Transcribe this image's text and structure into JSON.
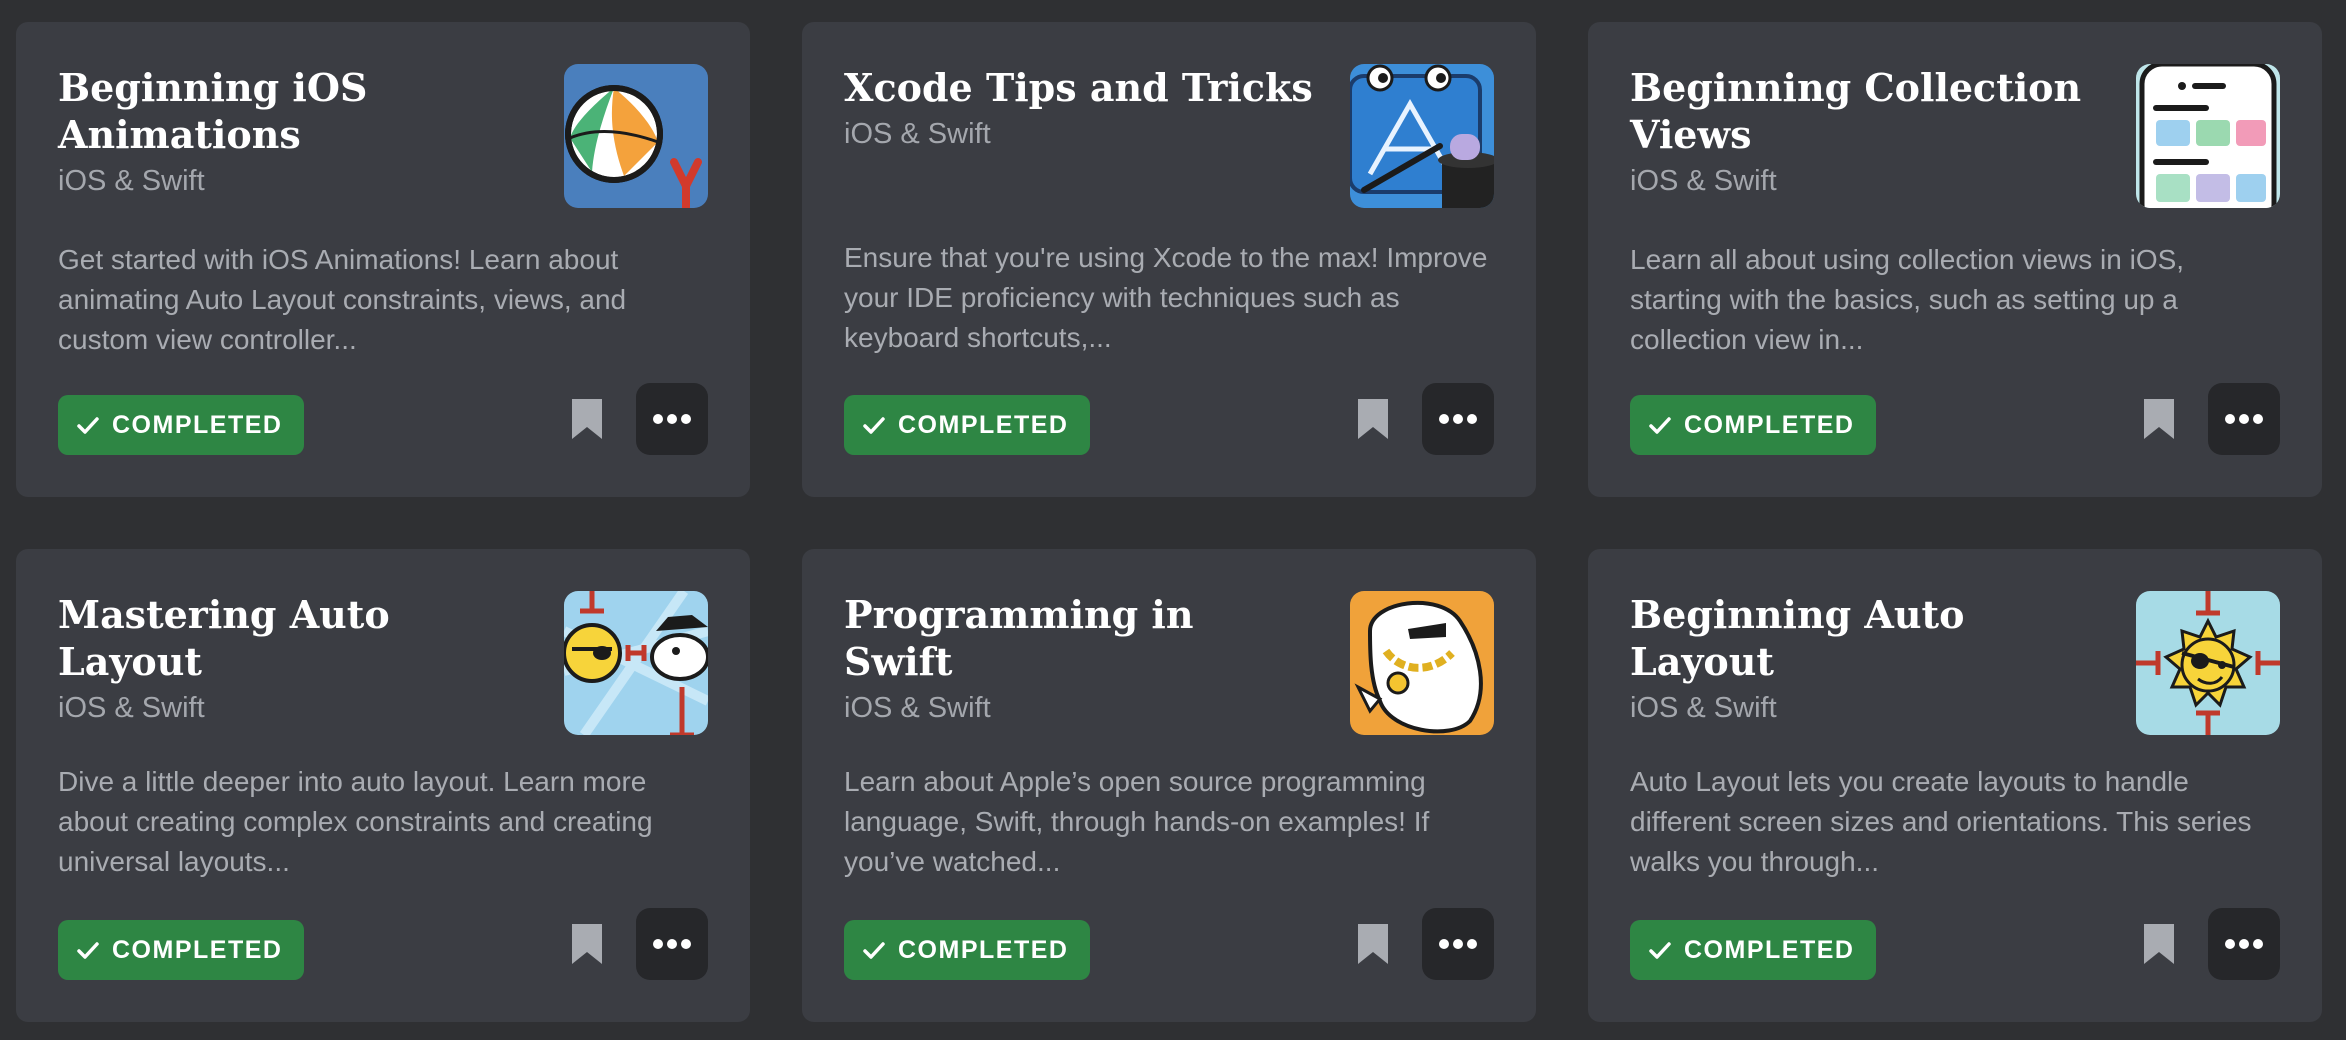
{
  "cards": [
    {
      "title": "Beginning iOS Animations",
      "category": "iOS & Swift",
      "description": "Get started with iOS Animations! Learn about animating Auto Layout constraints, views, and custom view controller...",
      "status": "COMPLETED",
      "thumbnail_icon": "beach-ball-icon",
      "thumbnail_bg": "#4a7fbd"
    },
    {
      "title": "Xcode Tips and Tricks",
      "category": "iOS & Swift",
      "description": "Ensure that you're using Xcode to the max! Improve your IDE proficiency with techniques such as keyboard shortcuts,...",
      "status": "COMPLETED",
      "thumbnail_icon": "xcode-magic-hat-icon",
      "thumbnail_bg": "#3d8fd9"
    },
    {
      "title": "Beginning Collection Views",
      "category": "iOS & Swift",
      "description": "Learn all about using collection views in iOS, starting with the basics, such as setting up a collection view in...",
      "status": "COMPLETED",
      "thumbnail_icon": "phone-grid-icon",
      "thumbnail_bg": "#bfe6ea"
    },
    {
      "title": "Mastering Auto Layout",
      "category": "iOS & Swift",
      "description": "Dive a little deeper into auto layout. Learn more about creating complex constraints and creating universal layouts...",
      "status": "COMPLETED",
      "thumbnail_icon": "pirate-sun-cloud-icon",
      "thumbnail_bg": "#9fd3ee"
    },
    {
      "title": "Programming in Swift",
      "category": "iOS & Swift",
      "description": "Learn about Apple’s open source programming language, Swift, through hands-on examples! If you’ve watched...",
      "status": "COMPLETED",
      "thumbnail_icon": "swift-bird-chain-icon",
      "thumbnail_bg": "#f0a23a"
    },
    {
      "title": "Beginning Auto Layout",
      "category": "iOS & Swift",
      "description": "Auto Layout lets you create layouts to handle different screen sizes and orientations. This series walks you through...",
      "status": "COMPLETED",
      "thumbnail_icon": "pirate-sun-icon",
      "thumbnail_bg": "#a7dbe6"
    }
  ],
  "colors": {
    "page_bg": "#2f3033",
    "card_bg": "#3b3d43",
    "completed_green": "#2e8644",
    "more_button_bg": "#26272a",
    "bookmark_gray": "#a9acb2"
  }
}
